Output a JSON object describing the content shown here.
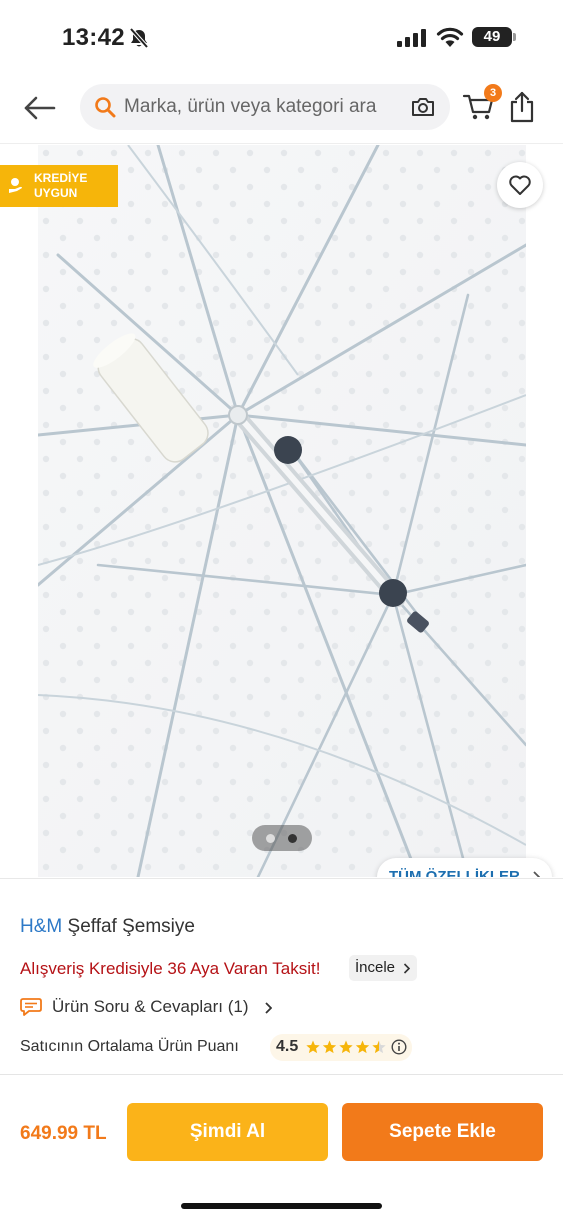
{
  "status_bar": {
    "time": "13:42",
    "battery": "49",
    "icons": [
      "bell-slash-icon",
      "signal-icon",
      "wifi-icon",
      "battery-icon"
    ]
  },
  "header": {
    "search_placeholder": "Marka, ürün veya kategori ara",
    "cart_count": "3",
    "icons": [
      "back-arrow-icon",
      "search-icon",
      "camera-icon",
      "cart-icon",
      "share-icon"
    ]
  },
  "gallery": {
    "badge_line1": "KREDİYE",
    "badge_line2": "UYGUN",
    "all_features_label": "TÜM ÖZELLİKLER",
    "page_count": 2,
    "active_page": 2
  },
  "product": {
    "brand": "H&M",
    "name": "Şeffaf Şemsiye",
    "promo_text": "Alışveriş Kredisiyle 36 Aya Varan Taksit!",
    "promo_link": "İncele",
    "qa_label": "Ürün Soru & Cevapları (1)",
    "seller_rating_label": "Satıcının Ortalama Ürün Puanı",
    "seller_rating": "4.5",
    "stars_filled": 4.5,
    "stars_max": 5
  },
  "bottom_bar": {
    "price": "649.99 TL",
    "buy_now_label": "Şimdi Al",
    "add_to_cart_label": "Sepete Ekle"
  },
  "colors": {
    "accent_orange": "#f27a1a",
    "buy_yellow": "#fbb319",
    "brand_blue": "#2d79c7",
    "promo_red": "#b51216"
  }
}
